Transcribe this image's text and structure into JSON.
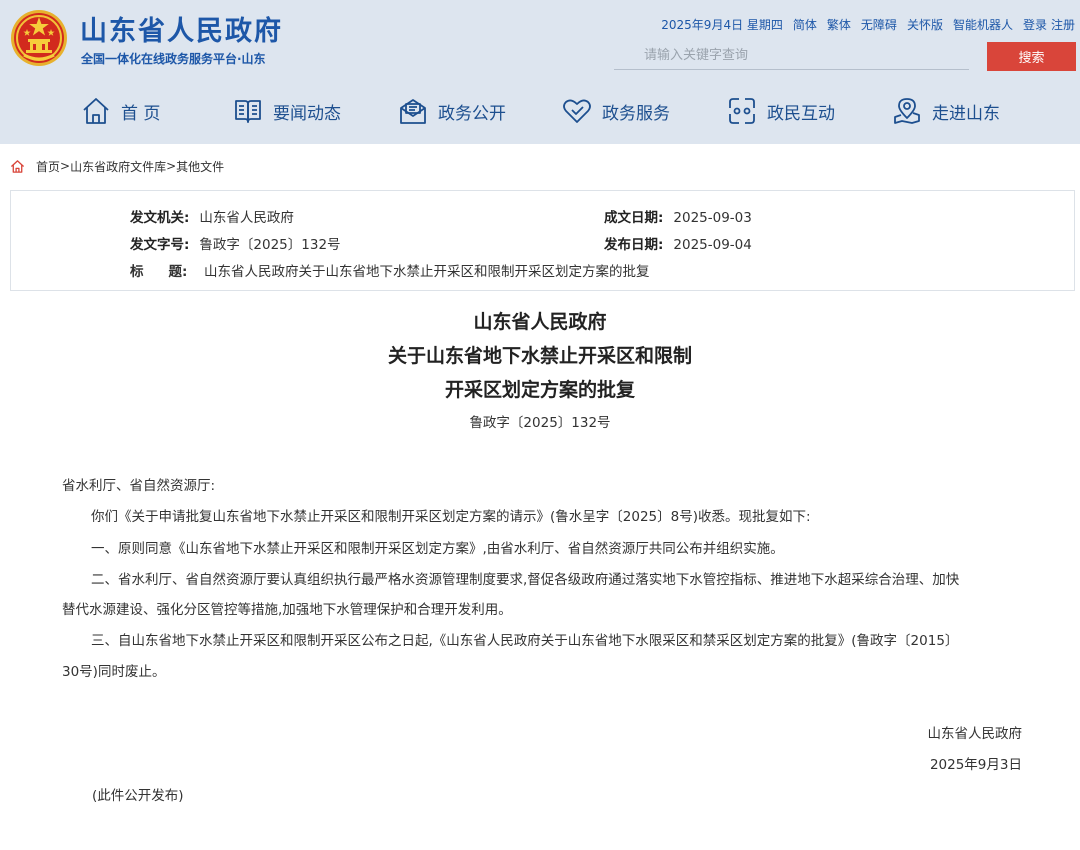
{
  "header": {
    "site_title": "山东省人民政府",
    "site_subtitle": "全国一体化在线政务服务平台·山东",
    "date": "2025年9月4日 星期四",
    "links": [
      "简体",
      "繁体",
      "无障碍",
      "关怀版",
      "智能机器人"
    ],
    "login": "登录",
    "register": "注册",
    "search_placeholder": "请输入关键字查询",
    "search_button": "搜索",
    "brand_color": "#1d57a8",
    "accent_color": "#d9453a"
  },
  "nav": {
    "items": [
      {
        "label": "首 页",
        "icon": "home-icon"
      },
      {
        "label": "要闻动态",
        "icon": "book-icon"
      },
      {
        "label": "政务公开",
        "icon": "open-mail-icon"
      },
      {
        "label": "政务服务",
        "icon": "heart-icon"
      },
      {
        "label": "政民互动",
        "icon": "interaction-icon"
      },
      {
        "label": "走进山东",
        "icon": "location-icon"
      }
    ]
  },
  "breadcrumb": {
    "icon": "home-icon",
    "items": [
      "首页",
      "山东省政府文件库",
      "其他文件"
    ]
  },
  "info": {
    "issuer_label": "发文机关:",
    "issuer": "山东省人民政府",
    "doc_no_label": "发文字号:",
    "doc_no": "鲁政字〔2025〕132号",
    "title_label_1": "标",
    "title_label_2": "题:",
    "title": "山东省人民政府关于山东省地下水禁止开采区和限制开采区划定方案的批复",
    "created_label": "成文日期:",
    "created": "2025-09-03",
    "published_label": "发布日期:",
    "published": "2025-09-04"
  },
  "document": {
    "title_lines": [
      "山东省人民政府",
      "关于山东省地下水禁止开采区和限制",
      "开采区划定方案的批复"
    ],
    "number": "鲁政字〔2025〕132号",
    "salutation": "省水利厅、省自然资源厅:",
    "paragraphs": [
      "你们《关于申请批复山东省地下水禁止开采区和限制开采区划定方案的请示》(鲁水呈字〔2025〕8号)收悉。现批复如下:",
      "一、原则同意《山东省地下水禁止开采区和限制开采区划定方案》,由省水利厅、省自然资源厅共同公布并组织实施。",
      "二、省水利厅、省自然资源厅要认真组织执行最严格水资源管理制度要求,督促各级政府通过落实地下水管控指标、推进地下水超采综合治理、加快",
      "替代水源建设、强化分区管控等措施,加强地下水管理保护和合理开发利用。",
      "三、自山东省地下水禁止开采区和限制开采区公布之日起,《山东省人民政府关于山东省地下水限采区和禁采区划定方案的批复》(鲁政字〔2015〕",
      "30号)同时废止。"
    ],
    "signer": "山东省人民政府",
    "sign_date": "2025年9月3日",
    "note": "(此件公开发布)"
  }
}
